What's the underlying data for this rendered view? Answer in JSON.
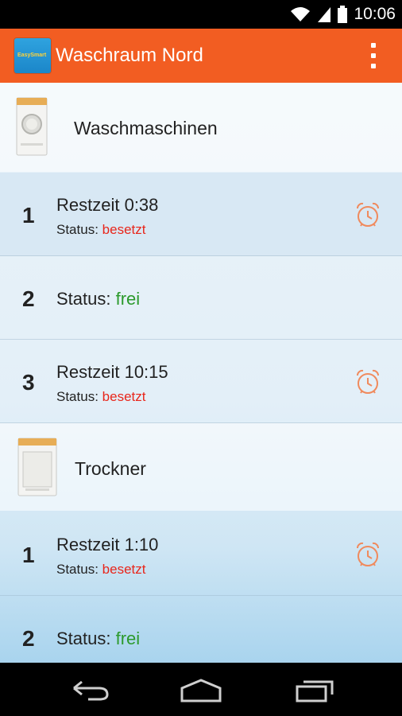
{
  "status_bar": {
    "time": "10:06"
  },
  "header": {
    "title": "Waschraum Nord",
    "logo_text": "EasySmart"
  },
  "sections": [
    {
      "title": "Waschmaschinen",
      "machines": [
        {
          "number": "1",
          "restzeit": "Restzeit 0:38",
          "status_label": "Status:",
          "status_value": "besetzt"
        },
        {
          "number": "2",
          "restzeit": "",
          "status_label": "Status:",
          "status_value": "frei"
        },
        {
          "number": "3",
          "restzeit": "Restzeit 10:15",
          "status_label": "Status:",
          "status_value": "besetzt"
        }
      ]
    },
    {
      "title": "Trockner",
      "machines": [
        {
          "number": "1",
          "restzeit": "Restzeit 1:10",
          "status_label": "Status:",
          "status_value": "besetzt"
        },
        {
          "number": "2",
          "restzeit": "",
          "status_label": "Status:",
          "status_value": "frei"
        }
      ]
    }
  ],
  "colors": {
    "accent": "#f25d22",
    "busy": "#e8261b",
    "free": "#2c9a2c",
    "alarm": "#f08a5d"
  },
  "icons": {
    "washer": "washing-machine-icon",
    "dryer": "dryer-icon",
    "alarm": "alarm-clock-icon",
    "back": "back-icon",
    "home": "home-icon",
    "recents": "recents-icon"
  }
}
